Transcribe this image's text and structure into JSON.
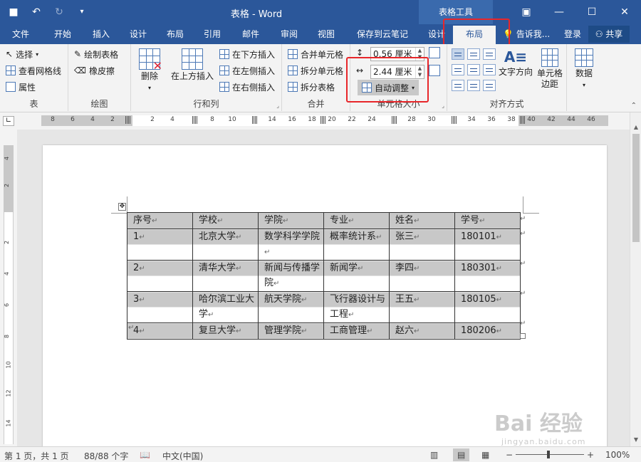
{
  "window": {
    "title": "表格 - Word",
    "context_tab_group": "表格工具",
    "qat": {
      "save_icon": "floppy-disk-icon",
      "undo_icon": "undo-icon",
      "redo_icon": "redo-icon",
      "customize_icon": "customize-qat-icon"
    },
    "controls": {
      "ribbon_display": "ribbon-display-icon",
      "minimize": "minimize-icon",
      "maximize": "maximize-icon",
      "close": "close-icon"
    }
  },
  "tabs": {
    "file": "文件",
    "home": "开始",
    "insert": "插入",
    "design": "设计",
    "layout_page": "布局",
    "references": "引用",
    "mailings": "邮件",
    "review": "审阅",
    "view": "视图",
    "save_cloud": "保存到云笔记",
    "table_design": "设计",
    "table_layout": "布局",
    "tell_me": "告诉我...",
    "login": "登录",
    "share": "共享"
  },
  "ribbon": {
    "table_group": {
      "label": "表",
      "select": "选择",
      "view_gridlines": "查看网格线",
      "properties": "属性"
    },
    "draw_group": {
      "label": "绘图",
      "draw_table": "绘制表格",
      "eraser": "橡皮擦"
    },
    "rows_cols_group": {
      "label": "行和列",
      "delete": "删除",
      "insert_above": "在上方插入",
      "insert_below": "在下方插入",
      "insert_left": "在左侧插入",
      "insert_right": "在右侧插入"
    },
    "merge_group": {
      "label": "合并",
      "merge_cells": "合并单元格",
      "split_cells": "拆分单元格",
      "split_table": "拆分表格"
    },
    "cell_size_group": {
      "label": "单元格大小",
      "height_value": "0.56 厘米",
      "width_value": "2.44 厘米",
      "autofit": "自动调整"
    },
    "alignment_group": {
      "label": "对齐方式",
      "text_direction": "文字方向",
      "cell_margins": "单元格\n边距"
    },
    "data_group": {
      "label": "数据"
    }
  },
  "ruler": {
    "ticks": [
      "8",
      "6",
      "4",
      "2",
      "2",
      "4",
      "8",
      "10",
      "14",
      "16",
      "18",
      "20",
      "22",
      "24",
      "28",
      "30",
      "34",
      "36",
      "38",
      "40",
      "42",
      "44",
      "46"
    ]
  },
  "vruler": {
    "ticks": [
      "4",
      "2",
      "2",
      "4",
      "6",
      "8",
      "10",
      "12",
      "14"
    ]
  },
  "table": {
    "headers": [
      "序号",
      "学校",
      "学院",
      "专业",
      "姓名",
      "学号"
    ],
    "rows": [
      [
        "1",
        "北京大学",
        "数学科学学院",
        "概率统计系",
        "张三",
        "180101"
      ],
      [
        "2",
        "清华大学",
        "新闻与传播学院",
        "新闻学",
        "李四",
        "180301"
      ],
      [
        "3",
        "哈尔滨工业大学",
        "航天学院",
        "飞行器设计与工程",
        "王五",
        "180105"
      ],
      [
        "4",
        "复旦大学",
        "管理学院",
        "工商管理",
        "赵六",
        "180206"
      ]
    ],
    "cell_mark": "↵"
  },
  "statusbar": {
    "page": "第 1 页，共 1 页",
    "words": "88/88 个字",
    "language": "中文(中国)",
    "zoom_minus": "−",
    "zoom_plus": "+",
    "zoom": "100%"
  },
  "watermark": {
    "brand": "Bai 经验",
    "url": "jingyan.baidu.com"
  },
  "colors": {
    "accent": "#2b579a",
    "highlight_box": "#e8262a"
  }
}
